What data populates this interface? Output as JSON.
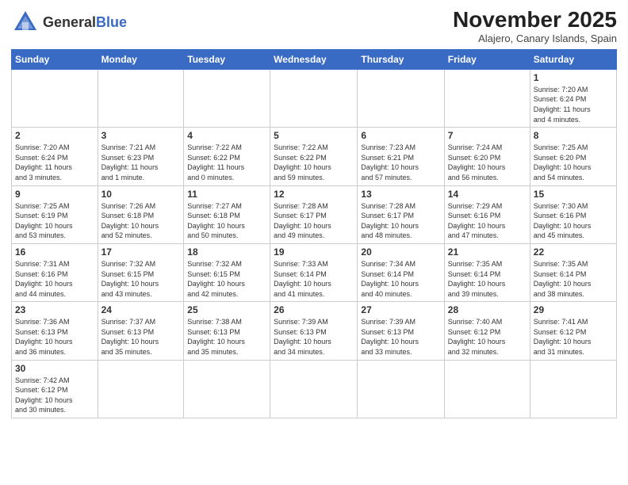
{
  "logo": {
    "text_general": "General",
    "text_blue": "Blue"
  },
  "header": {
    "month": "November 2025",
    "location": "Alajero, Canary Islands, Spain"
  },
  "weekdays": [
    "Sunday",
    "Monday",
    "Tuesday",
    "Wednesday",
    "Thursday",
    "Friday",
    "Saturday"
  ],
  "weeks": [
    [
      {
        "day": "",
        "info": ""
      },
      {
        "day": "",
        "info": ""
      },
      {
        "day": "",
        "info": ""
      },
      {
        "day": "",
        "info": ""
      },
      {
        "day": "",
        "info": ""
      },
      {
        "day": "",
        "info": ""
      },
      {
        "day": "1",
        "info": "Sunrise: 7:20 AM\nSunset: 6:24 PM\nDaylight: 11 hours\nand 4 minutes."
      }
    ],
    [
      {
        "day": "2",
        "info": "Sunrise: 7:20 AM\nSunset: 6:24 PM\nDaylight: 11 hours\nand 3 minutes."
      },
      {
        "day": "3",
        "info": "Sunrise: 7:21 AM\nSunset: 6:23 PM\nDaylight: 11 hours\nand 1 minute."
      },
      {
        "day": "4",
        "info": "Sunrise: 7:22 AM\nSunset: 6:22 PM\nDaylight: 11 hours\nand 0 minutes."
      },
      {
        "day": "5",
        "info": "Sunrise: 7:22 AM\nSunset: 6:22 PM\nDaylight: 10 hours\nand 59 minutes."
      },
      {
        "day": "6",
        "info": "Sunrise: 7:23 AM\nSunset: 6:21 PM\nDaylight: 10 hours\nand 57 minutes."
      },
      {
        "day": "7",
        "info": "Sunrise: 7:24 AM\nSunset: 6:20 PM\nDaylight: 10 hours\nand 56 minutes."
      },
      {
        "day": "8",
        "info": "Sunrise: 7:25 AM\nSunset: 6:20 PM\nDaylight: 10 hours\nand 54 minutes."
      }
    ],
    [
      {
        "day": "9",
        "info": "Sunrise: 7:25 AM\nSunset: 6:19 PM\nDaylight: 10 hours\nand 53 minutes."
      },
      {
        "day": "10",
        "info": "Sunrise: 7:26 AM\nSunset: 6:18 PM\nDaylight: 10 hours\nand 52 minutes."
      },
      {
        "day": "11",
        "info": "Sunrise: 7:27 AM\nSunset: 6:18 PM\nDaylight: 10 hours\nand 50 minutes."
      },
      {
        "day": "12",
        "info": "Sunrise: 7:28 AM\nSunset: 6:17 PM\nDaylight: 10 hours\nand 49 minutes."
      },
      {
        "day": "13",
        "info": "Sunrise: 7:28 AM\nSunset: 6:17 PM\nDaylight: 10 hours\nand 48 minutes."
      },
      {
        "day": "14",
        "info": "Sunrise: 7:29 AM\nSunset: 6:16 PM\nDaylight: 10 hours\nand 47 minutes."
      },
      {
        "day": "15",
        "info": "Sunrise: 7:30 AM\nSunset: 6:16 PM\nDaylight: 10 hours\nand 45 minutes."
      }
    ],
    [
      {
        "day": "16",
        "info": "Sunrise: 7:31 AM\nSunset: 6:16 PM\nDaylight: 10 hours\nand 44 minutes."
      },
      {
        "day": "17",
        "info": "Sunrise: 7:32 AM\nSunset: 6:15 PM\nDaylight: 10 hours\nand 43 minutes."
      },
      {
        "day": "18",
        "info": "Sunrise: 7:32 AM\nSunset: 6:15 PM\nDaylight: 10 hours\nand 42 minutes."
      },
      {
        "day": "19",
        "info": "Sunrise: 7:33 AM\nSunset: 6:14 PM\nDaylight: 10 hours\nand 41 minutes."
      },
      {
        "day": "20",
        "info": "Sunrise: 7:34 AM\nSunset: 6:14 PM\nDaylight: 10 hours\nand 40 minutes."
      },
      {
        "day": "21",
        "info": "Sunrise: 7:35 AM\nSunset: 6:14 PM\nDaylight: 10 hours\nand 39 minutes."
      },
      {
        "day": "22",
        "info": "Sunrise: 7:35 AM\nSunset: 6:14 PM\nDaylight: 10 hours\nand 38 minutes."
      }
    ],
    [
      {
        "day": "23",
        "info": "Sunrise: 7:36 AM\nSunset: 6:13 PM\nDaylight: 10 hours\nand 36 minutes."
      },
      {
        "day": "24",
        "info": "Sunrise: 7:37 AM\nSunset: 6:13 PM\nDaylight: 10 hours\nand 35 minutes."
      },
      {
        "day": "25",
        "info": "Sunrise: 7:38 AM\nSunset: 6:13 PM\nDaylight: 10 hours\nand 35 minutes."
      },
      {
        "day": "26",
        "info": "Sunrise: 7:39 AM\nSunset: 6:13 PM\nDaylight: 10 hours\nand 34 minutes."
      },
      {
        "day": "27",
        "info": "Sunrise: 7:39 AM\nSunset: 6:13 PM\nDaylight: 10 hours\nand 33 minutes."
      },
      {
        "day": "28",
        "info": "Sunrise: 7:40 AM\nSunset: 6:12 PM\nDaylight: 10 hours\nand 32 minutes."
      },
      {
        "day": "29",
        "info": "Sunrise: 7:41 AM\nSunset: 6:12 PM\nDaylight: 10 hours\nand 31 minutes."
      }
    ],
    [
      {
        "day": "30",
        "info": "Sunrise: 7:42 AM\nSunset: 6:12 PM\nDaylight: 10 hours\nand 30 minutes."
      },
      {
        "day": "",
        "info": ""
      },
      {
        "day": "",
        "info": ""
      },
      {
        "day": "",
        "info": ""
      },
      {
        "day": "",
        "info": ""
      },
      {
        "day": "",
        "info": ""
      },
      {
        "day": "",
        "info": ""
      }
    ]
  ]
}
